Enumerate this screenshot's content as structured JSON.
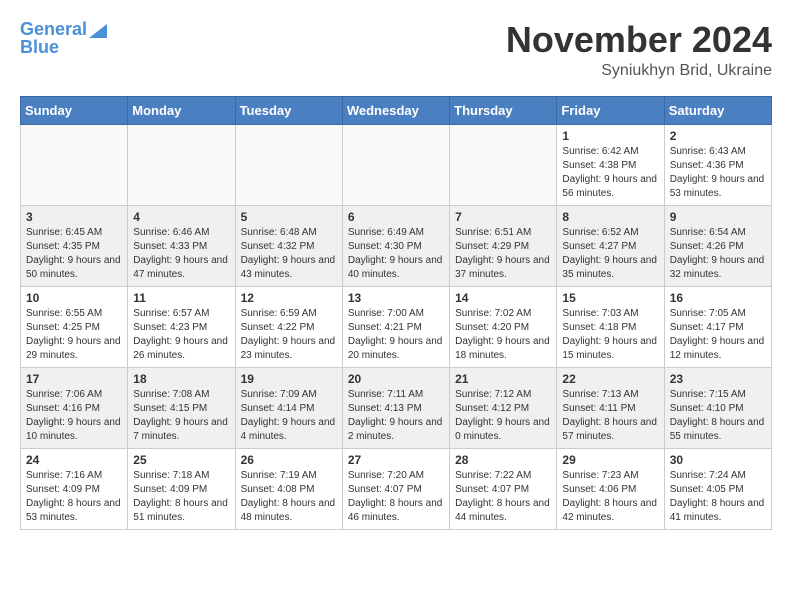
{
  "header": {
    "logo_line1": "General",
    "logo_line2": "Blue",
    "title": "November 2024",
    "subtitle": "Syniukhyn Brid, Ukraine"
  },
  "weekdays": [
    "Sunday",
    "Monday",
    "Tuesday",
    "Wednesday",
    "Thursday",
    "Friday",
    "Saturday"
  ],
  "weeks": [
    [
      {
        "day": "",
        "info": ""
      },
      {
        "day": "",
        "info": ""
      },
      {
        "day": "",
        "info": ""
      },
      {
        "day": "",
        "info": ""
      },
      {
        "day": "",
        "info": ""
      },
      {
        "day": "1",
        "info": "Sunrise: 6:42 AM\nSunset: 4:38 PM\nDaylight: 9 hours and 56 minutes."
      },
      {
        "day": "2",
        "info": "Sunrise: 6:43 AM\nSunset: 4:36 PM\nDaylight: 9 hours and 53 minutes."
      }
    ],
    [
      {
        "day": "3",
        "info": "Sunrise: 6:45 AM\nSunset: 4:35 PM\nDaylight: 9 hours and 50 minutes."
      },
      {
        "day": "4",
        "info": "Sunrise: 6:46 AM\nSunset: 4:33 PM\nDaylight: 9 hours and 47 minutes."
      },
      {
        "day": "5",
        "info": "Sunrise: 6:48 AM\nSunset: 4:32 PM\nDaylight: 9 hours and 43 minutes."
      },
      {
        "day": "6",
        "info": "Sunrise: 6:49 AM\nSunset: 4:30 PM\nDaylight: 9 hours and 40 minutes."
      },
      {
        "day": "7",
        "info": "Sunrise: 6:51 AM\nSunset: 4:29 PM\nDaylight: 9 hours and 37 minutes."
      },
      {
        "day": "8",
        "info": "Sunrise: 6:52 AM\nSunset: 4:27 PM\nDaylight: 9 hours and 35 minutes."
      },
      {
        "day": "9",
        "info": "Sunrise: 6:54 AM\nSunset: 4:26 PM\nDaylight: 9 hours and 32 minutes."
      }
    ],
    [
      {
        "day": "10",
        "info": "Sunrise: 6:55 AM\nSunset: 4:25 PM\nDaylight: 9 hours and 29 minutes."
      },
      {
        "day": "11",
        "info": "Sunrise: 6:57 AM\nSunset: 4:23 PM\nDaylight: 9 hours and 26 minutes."
      },
      {
        "day": "12",
        "info": "Sunrise: 6:59 AM\nSunset: 4:22 PM\nDaylight: 9 hours and 23 minutes."
      },
      {
        "day": "13",
        "info": "Sunrise: 7:00 AM\nSunset: 4:21 PM\nDaylight: 9 hours and 20 minutes."
      },
      {
        "day": "14",
        "info": "Sunrise: 7:02 AM\nSunset: 4:20 PM\nDaylight: 9 hours and 18 minutes."
      },
      {
        "day": "15",
        "info": "Sunrise: 7:03 AM\nSunset: 4:18 PM\nDaylight: 9 hours and 15 minutes."
      },
      {
        "day": "16",
        "info": "Sunrise: 7:05 AM\nSunset: 4:17 PM\nDaylight: 9 hours and 12 minutes."
      }
    ],
    [
      {
        "day": "17",
        "info": "Sunrise: 7:06 AM\nSunset: 4:16 PM\nDaylight: 9 hours and 10 minutes."
      },
      {
        "day": "18",
        "info": "Sunrise: 7:08 AM\nSunset: 4:15 PM\nDaylight: 9 hours and 7 minutes."
      },
      {
        "day": "19",
        "info": "Sunrise: 7:09 AM\nSunset: 4:14 PM\nDaylight: 9 hours and 4 minutes."
      },
      {
        "day": "20",
        "info": "Sunrise: 7:11 AM\nSunset: 4:13 PM\nDaylight: 9 hours and 2 minutes."
      },
      {
        "day": "21",
        "info": "Sunrise: 7:12 AM\nSunset: 4:12 PM\nDaylight: 9 hours and 0 minutes."
      },
      {
        "day": "22",
        "info": "Sunrise: 7:13 AM\nSunset: 4:11 PM\nDaylight: 8 hours and 57 minutes."
      },
      {
        "day": "23",
        "info": "Sunrise: 7:15 AM\nSunset: 4:10 PM\nDaylight: 8 hours and 55 minutes."
      }
    ],
    [
      {
        "day": "24",
        "info": "Sunrise: 7:16 AM\nSunset: 4:09 PM\nDaylight: 8 hours and 53 minutes."
      },
      {
        "day": "25",
        "info": "Sunrise: 7:18 AM\nSunset: 4:09 PM\nDaylight: 8 hours and 51 minutes."
      },
      {
        "day": "26",
        "info": "Sunrise: 7:19 AM\nSunset: 4:08 PM\nDaylight: 8 hours and 48 minutes."
      },
      {
        "day": "27",
        "info": "Sunrise: 7:20 AM\nSunset: 4:07 PM\nDaylight: 8 hours and 46 minutes."
      },
      {
        "day": "28",
        "info": "Sunrise: 7:22 AM\nSunset: 4:07 PM\nDaylight: 8 hours and 44 minutes."
      },
      {
        "day": "29",
        "info": "Sunrise: 7:23 AM\nSunset: 4:06 PM\nDaylight: 8 hours and 42 minutes."
      },
      {
        "day": "30",
        "info": "Sunrise: 7:24 AM\nSunset: 4:05 PM\nDaylight: 8 hours and 41 minutes."
      }
    ]
  ]
}
